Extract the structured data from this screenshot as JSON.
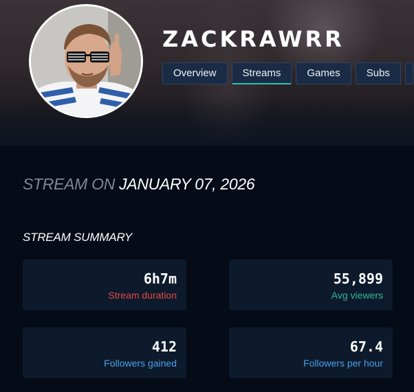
{
  "channel": {
    "name": "ZACKRAWRR"
  },
  "nav": {
    "tabs": [
      {
        "label": "Overview",
        "active": false
      },
      {
        "label": "Streams",
        "active": true
      },
      {
        "label": "Games",
        "active": false
      },
      {
        "label": "Subs",
        "active": false
      }
    ]
  },
  "stream": {
    "prefix": "STREAM ON",
    "date": "JANUARY 07, 2026"
  },
  "summary": {
    "title": "STREAM SUMMARY",
    "stats": [
      {
        "value": "6h7m",
        "label": "Stream duration",
        "color": "#e5484d"
      },
      {
        "value": "55,899",
        "label": "Avg viewers",
        "color": "#2fb89a"
      },
      {
        "value": "412",
        "label": "Followers gained",
        "color": "#4a9fe8"
      },
      {
        "value": "67.4",
        "label": "Followers per hour",
        "color": "#4a9fe8"
      }
    ]
  },
  "colors": {
    "accent": "#27c6b0",
    "background": "#050b17",
    "card": "#0d1a2b"
  },
  "icons": {
    "avatar": "avatar-photo"
  }
}
